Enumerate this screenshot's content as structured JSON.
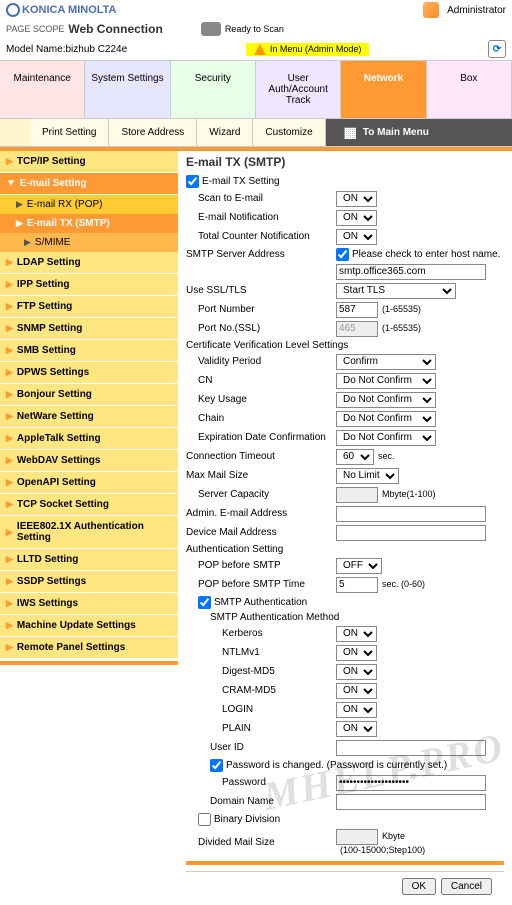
{
  "brand": "KONICA MINOLTA",
  "pagescope": "PAGE SCOPE",
  "webconn": "Web Connection",
  "admin": "Administrator",
  "ready": "Ready to Scan",
  "model_lbl": "Model Name:",
  "model": "bizhub C224e",
  "mode": "In Menu (Admin Mode)",
  "tabs1": {
    "maint": "Maintenance",
    "sys": "System Settings",
    "sec": "Security",
    "user": "User Auth/Account Track",
    "net": "Network",
    "box": "Box"
  },
  "tabs2": {
    "print": "Print Setting",
    "store": "Store Address",
    "wiz": "Wizard",
    "cust": "Customize",
    "main": "To Main Menu"
  },
  "sb": {
    "tcpip": "TCP/IP Setting",
    "email": "E-mail Setting",
    "rx": "E-mail RX (POP)",
    "tx": "E-mail TX (SMTP)",
    "smime": "S/MIME",
    "ldap": "LDAP Setting",
    "ipp": "IPP Setting",
    "ftp": "FTP Setting",
    "snmp": "SNMP Setting",
    "smb": "SMB Setting",
    "dpws": "DPWS Settings",
    "bonjour": "Bonjour Setting",
    "netware": "NetWare Setting",
    "apple": "AppleTalk Setting",
    "webdav": "WebDAV Settings",
    "openapi": "OpenAPI Setting",
    "tcpsock": "TCP Socket Setting",
    "ieee": "IEEE802.1X Authentication Setting",
    "lltd": "LLTD Setting",
    "ssdp": "SSDP Settings",
    "iws": "IWS Settings",
    "machine": "Machine Update Settings",
    "remote": "Remote Panel Settings"
  },
  "title": "E-mail TX (SMTP)",
  "f": {
    "txset": "E-mail TX Setting",
    "scan": "Scan to E-mail",
    "notif": "E-mail Notification",
    "total": "Total Counter Notification",
    "server": "SMTP Server Address",
    "hostchk": "Please check to enter host name.",
    "host": "smtp.office365.com",
    "ssl": "Use SSL/TLS",
    "ssl_v": "Start TLS",
    "port": "Port Number",
    "port_v": "587",
    "port_h": "(1-65535)",
    "portssl": "Port No.(SSL)",
    "portssl_v": "465",
    "cert": "Certificate Verification Level Settings",
    "valid": "Validity Period",
    "valid_v": "Confirm",
    "cn": "CN",
    "dnc": "Do Not Confirm",
    "key": "Key Usage",
    "chain": "Chain",
    "exp": "Expiration Date Confirmation",
    "timeout": "Connection Timeout",
    "timeout_v": "60",
    "sec": "sec.",
    "maxmail": "Max Mail Size",
    "nolimit": "No Limit",
    "scap": "Server Capacity",
    "mbyte": "Mbyte(1-100)",
    "adminmail": "Admin. E-mail Address",
    "devmail": "Device Mail Address",
    "auth": "Authentication Setting",
    "popsmtp": "POP before SMTP",
    "off": "OFF",
    "poptime": "POP before SMTP Time",
    "poptime_v": "5",
    "sec60": "sec. (0-60)",
    "smtpauth": "SMTP Authentication",
    "smtpmethod": "SMTP Authentication Method",
    "kerb": "Kerberos",
    "ntlm": "NTLMv1",
    "digest": "Digest-MD5",
    "cram": "CRAM-MD5",
    "login": "LOGIN",
    "plain": "PLAIN",
    "on": "ON",
    "userid": "User ID",
    "pwdchg": "Password is changed.",
    "pwdset": "(Password is currently set.)",
    "pwd": "Password",
    "pwd_v": "••••••••••••••••••••",
    "domain": "Domain Name",
    "binary": "Binary Division",
    "divsize": "Divided Mail Size",
    "kbyte": "Kbyte",
    "kbyte_h": "(100-15000;Step100)"
  },
  "ok": "OK",
  "cancel": "Cancel",
  "watermark": "MHELP.PRO"
}
